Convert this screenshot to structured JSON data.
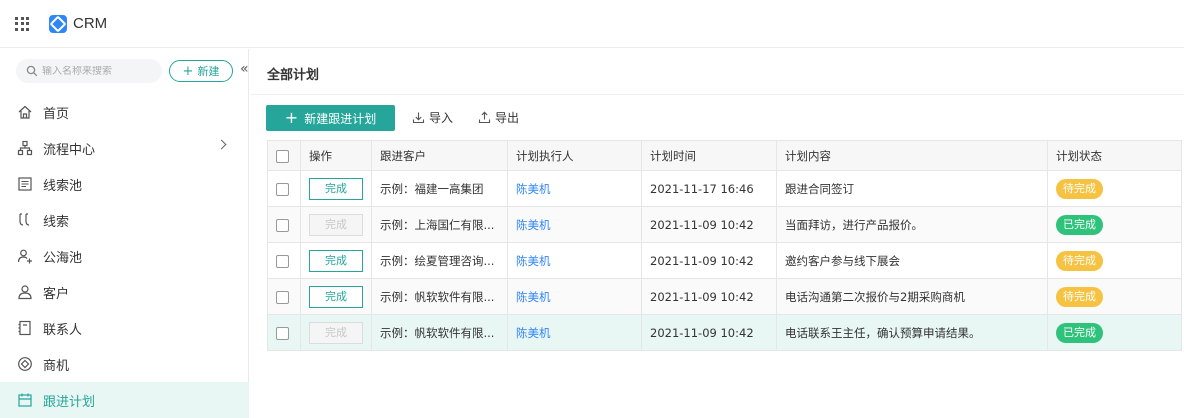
{
  "app": {
    "title": "CRM"
  },
  "sidebar": {
    "search_placeholder": "输入名称来搜索",
    "new_label": "新建",
    "collapse_glyph": "«",
    "items": [
      {
        "label": "首页",
        "icon": "home-icon"
      },
      {
        "label": "流程中心",
        "icon": "flow-icon",
        "has_arrow": true
      },
      {
        "label": "线索池",
        "icon": "lead-pool-icon"
      },
      {
        "label": "线索",
        "icon": "lead-icon"
      },
      {
        "label": "公海池",
        "icon": "public-pool-icon"
      },
      {
        "label": "客户",
        "icon": "customer-icon"
      },
      {
        "label": "联系人",
        "icon": "contact-icon"
      },
      {
        "label": "商机",
        "icon": "opportunity-icon"
      },
      {
        "label": "跟进计划",
        "icon": "plan-icon",
        "active": true
      }
    ]
  },
  "main": {
    "title": "全部计划",
    "toolbar": {
      "new_plan": "新建跟进计划",
      "import": "导入",
      "export": "导出"
    },
    "table": {
      "headers": [
        "操作",
        "跟进客户",
        "计划执行人",
        "计划时间",
        "计划内容",
        "计划状态"
      ],
      "rows": [
        {
          "action": "完成",
          "action_disabled": false,
          "customer": "示例：福建一高集团",
          "executor": "陈美机",
          "time": "2021-11-17 16:46",
          "content": "跟进合同签订",
          "status": "待完成",
          "status_color": "#f5c242"
        },
        {
          "action": "完成",
          "action_disabled": true,
          "customer": "示例：上海国仁有限...",
          "executor": "陈美机",
          "time": "2021-11-09 10:42",
          "content": "当面拜访，进行产品报价。",
          "status": "已完成",
          "status_color": "#2fc27b"
        },
        {
          "action": "完成",
          "action_disabled": false,
          "customer": "示例：绘夏管理咨询...",
          "executor": "陈美机",
          "time": "2021-11-09 10:42",
          "content": "邀约客户参与线下展会",
          "status": "待完成",
          "status_color": "#f5c242"
        },
        {
          "action": "完成",
          "action_disabled": false,
          "customer": "示例：帆软软件有限...",
          "executor": "陈美机",
          "time": "2021-11-09 10:42",
          "content": "电话沟通第二次报价与2期采购商机",
          "status": "待完成",
          "status_color": "#f5c242"
        },
        {
          "action": "完成",
          "action_disabled": true,
          "customer": "示例：帆软软件有限...",
          "executor": "陈美机",
          "time": "2021-11-09 10:42",
          "content": "电话联系王主任，确认预算申请结果。",
          "status": "已完成",
          "status_color": "#2fc27b"
        }
      ]
    }
  },
  "colors": {
    "accent": "#26a69a",
    "link": "#2f86f6",
    "pending": "#f5c242",
    "done": "#2fc27b"
  }
}
